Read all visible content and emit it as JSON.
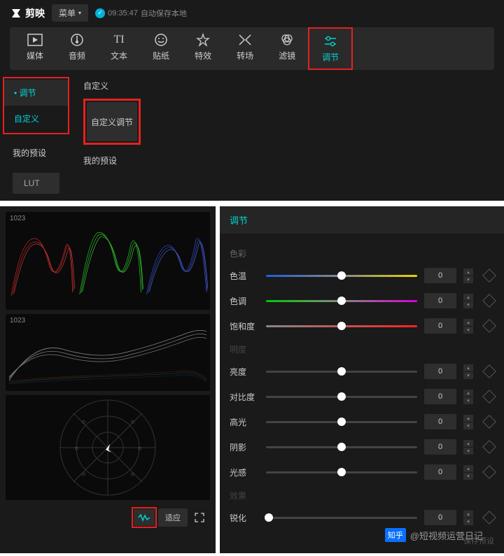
{
  "app": {
    "name": "剪映",
    "menu_label": "菜单",
    "autosave_time": "09:35:47",
    "autosave_text": "自动保存本地"
  },
  "main_tabs": [
    {
      "label": "媒体"
    },
    {
      "label": "音频"
    },
    {
      "label": "文本"
    },
    {
      "label": "贴纸"
    },
    {
      "label": "特效"
    },
    {
      "label": "转场"
    },
    {
      "label": "滤镜"
    },
    {
      "label": "调节"
    }
  ],
  "side": {
    "adjust": "• 调节",
    "custom": "自定义",
    "my_presets": "我的预设",
    "lut": "LUT"
  },
  "content": {
    "custom_label": "自定义",
    "card_label": "自定义调节",
    "presets_label": "我的预设"
  },
  "scopes": {
    "label1": "1023",
    "label2": "1023",
    "fit_label": "适应"
  },
  "adjust": {
    "title": "调节",
    "group_color": "色彩",
    "group_luma": "明度",
    "group_sharp": "效果",
    "sliders": {
      "temp": {
        "label": "色温",
        "value": "0",
        "pos": 50
      },
      "tint": {
        "label": "色调",
        "value": "0",
        "pos": 50
      },
      "sat": {
        "label": "饱和度",
        "value": "0",
        "pos": 50
      },
      "bright": {
        "label": "亮度",
        "value": "0",
        "pos": 50
      },
      "contrast": {
        "label": "对比度",
        "value": "0",
        "pos": 50
      },
      "high": {
        "label": "高光",
        "value": "0",
        "pos": 50
      },
      "shadow": {
        "label": "阴影",
        "value": "0",
        "pos": 50
      },
      "light": {
        "label": "光感",
        "value": "0",
        "pos": 50
      },
      "sharp": {
        "label": "锐化",
        "value": "0",
        "pos": 2
      }
    },
    "save_preset": "保存预设"
  },
  "watermark": {
    "brand": "知乎",
    "text": "@短视频运营日记"
  }
}
